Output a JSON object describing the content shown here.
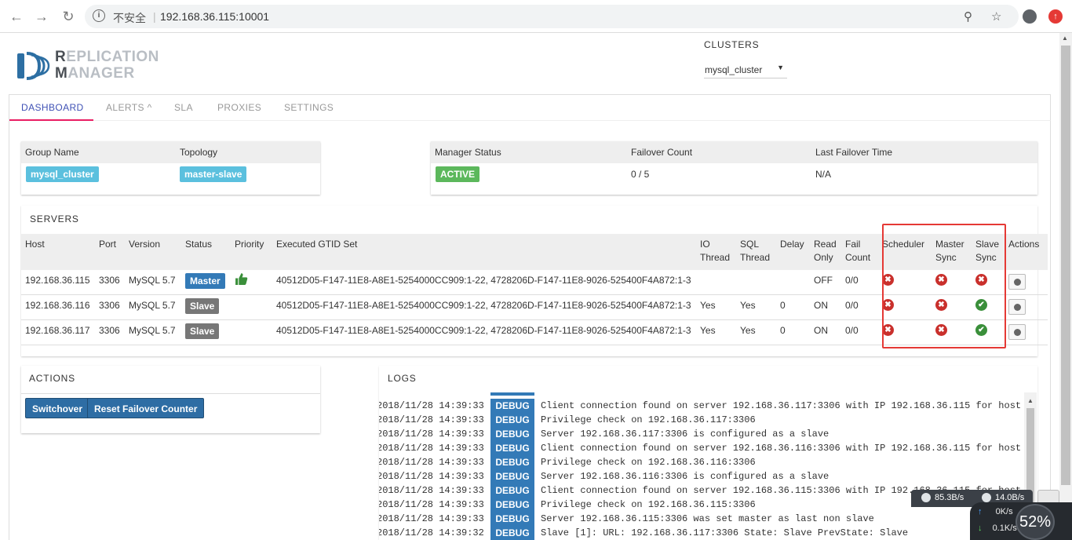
{
  "browser": {
    "security_label": "不安全",
    "url": "192.168.36.115:10001",
    "info_glyph": "i"
  },
  "logo": {
    "line1_hl": "R",
    "line1_rest": "EPLICATION",
    "line2_hl": "M",
    "line2_rest": "ANAGER"
  },
  "clusters": {
    "label": "CLUSTERS",
    "selected": "mysql_cluster"
  },
  "tabs": [
    "DASHBOARD",
    "ALERTS ^",
    "SLA",
    "PROXIES",
    "SETTINGS"
  ],
  "group_card": {
    "col1": "Group Name",
    "col2": "Topology",
    "group_name": "mysql_cluster",
    "topology": "master-slave"
  },
  "manager_card": {
    "col1": "Manager Status",
    "col2": "Failover Count",
    "col3": "Last Failover Time",
    "status": "ACTIVE",
    "failover_count": "0 / 5",
    "last_failover": "N/A"
  },
  "servers": {
    "title": "SERVERS",
    "headers": {
      "host": "Host",
      "port": "Port",
      "version": "Version",
      "status": "Status",
      "priority": "Priority",
      "gtid": "Executed GTID Set",
      "io1": "IO",
      "io2": "Thread",
      "sql1": "SQL",
      "sql2": "Thread",
      "delay": "Delay",
      "ro1": "Read",
      "ro2": "Only",
      "fc1": "Fail",
      "fc2": "Count",
      "sched": "Scheduler",
      "ms1": "Master",
      "ms2": "Sync",
      "ss1": "Slave",
      "ss2": "Sync",
      "actions": "Actions"
    },
    "rows": [
      {
        "host": "192.168.36.115",
        "port": "3306",
        "version": "MySQL 5.7",
        "status": "Master",
        "gtid": "40512D05-F147-11E8-A8E1-5254000CC909:1-22, 4728206D-F147-11E8-9026-525400F4A872:1-3",
        "io": "",
        "sql": "",
        "delay": "",
        "read_only": "OFF",
        "fail_count": "0/0",
        "scheduler": "error",
        "master_sync": "error",
        "slave_sync": "error"
      },
      {
        "host": "192.168.36.116",
        "port": "3306",
        "version": "MySQL 5.7",
        "status": "Slave",
        "gtid": "40512D05-F147-11E8-A8E1-5254000CC909:1-22, 4728206D-F147-11E8-9026-525400F4A872:1-3",
        "io": "Yes",
        "sql": "Yes",
        "delay": "0",
        "read_only": "ON",
        "fail_count": "0/0",
        "scheduler": "error",
        "master_sync": "error",
        "slave_sync": "ok"
      },
      {
        "host": "192.168.36.117",
        "port": "3306",
        "version": "MySQL 5.7",
        "status": "Slave",
        "gtid": "40512D05-F147-11E8-A8E1-5254000CC909:1-22, 4728206D-F147-11E8-9026-525400F4A872:1-3",
        "io": "Yes",
        "sql": "Yes",
        "delay": "0",
        "read_only": "ON",
        "fail_count": "0/0",
        "scheduler": "error",
        "master_sync": "error",
        "slave_sync": "ok"
      }
    ],
    "icons": {
      "error": "✖",
      "ok": "✔"
    }
  },
  "actions": {
    "title": "ACTIONS",
    "switchover": "Switchover",
    "reset": "Reset Failover Counter"
  },
  "logs": {
    "title": "LOGS",
    "lines": [
      {
        "ts": "2018/11/28 14:39:33",
        "level": "DEBUG",
        "msg": "Client connection found on server 192.168.36.117:3306 with IP 192.168.36.115 for host"
      },
      {
        "ts": "2018/11/28 14:39:33",
        "level": "DEBUG",
        "msg": "Privilege check on 192.168.36.117:3306"
      },
      {
        "ts": "2018/11/28 14:39:33",
        "level": "DEBUG",
        "msg": "Server 192.168.36.117:3306 is configured as a slave"
      },
      {
        "ts": "2018/11/28 14:39:33",
        "level": "DEBUG",
        "msg": "Client connection found on server 192.168.36.116:3306 with IP 192.168.36.115 for host"
      },
      {
        "ts": "2018/11/28 14:39:33",
        "level": "DEBUG",
        "msg": "Privilege check on 192.168.36.116:3306"
      },
      {
        "ts": "2018/11/28 14:39:33",
        "level": "DEBUG",
        "msg": "Server 192.168.36.116:3306 is configured as a slave"
      },
      {
        "ts": "2018/11/28 14:39:33",
        "level": "DEBUG",
        "msg": "Client connection found on server 192.168.36.115:3306 with IP 192.168.36.115 for host"
      },
      {
        "ts": "2018/11/28 14:39:33",
        "level": "DEBUG",
        "msg": "Privilege check on 192.168.36.115:3306"
      },
      {
        "ts": "2018/11/28 14:39:33",
        "level": "DEBUG",
        "msg": "Server 192.168.36.115:3306 was set master as last non slave"
      },
      {
        "ts": "2018/11/28 14:39:32",
        "level": "DEBUG",
        "msg": "Slave [1]: URL: 192.168.36.117:3306 State: Slave PrevState: Slave"
      }
    ]
  },
  "net_widget": {
    "down": "85.3B/s",
    "up": "14.0B/s",
    "line1": "0K/s",
    "line2": "0.1K/s",
    "percent": "52%"
  }
}
